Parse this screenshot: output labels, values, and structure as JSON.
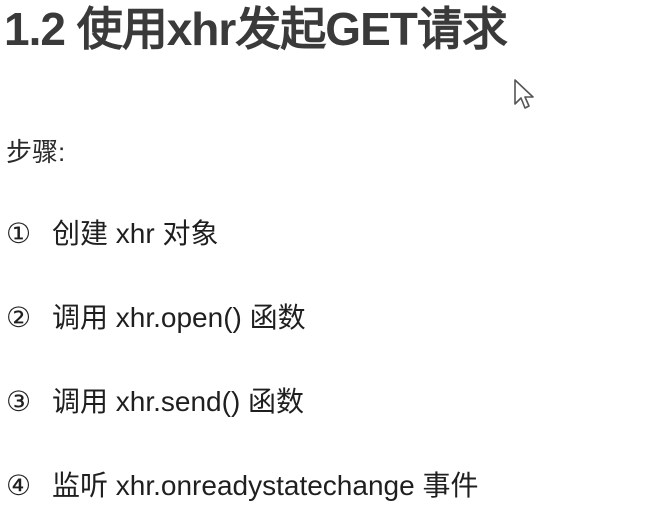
{
  "title": "1.2 使用xhr发起GET请求",
  "subtitle": "步骤:",
  "steps": [
    {
      "number": "①",
      "text": "创建 xhr 对象"
    },
    {
      "number": "②",
      "text": "调用 xhr.open() 函数"
    },
    {
      "number": "③",
      "text": "调用 xhr.send() 函数"
    },
    {
      "number": "④",
      "text": "监听 xhr.onreadystatechange 事件"
    }
  ],
  "icons": {
    "cursor": "mouse-pointer-icon"
  }
}
